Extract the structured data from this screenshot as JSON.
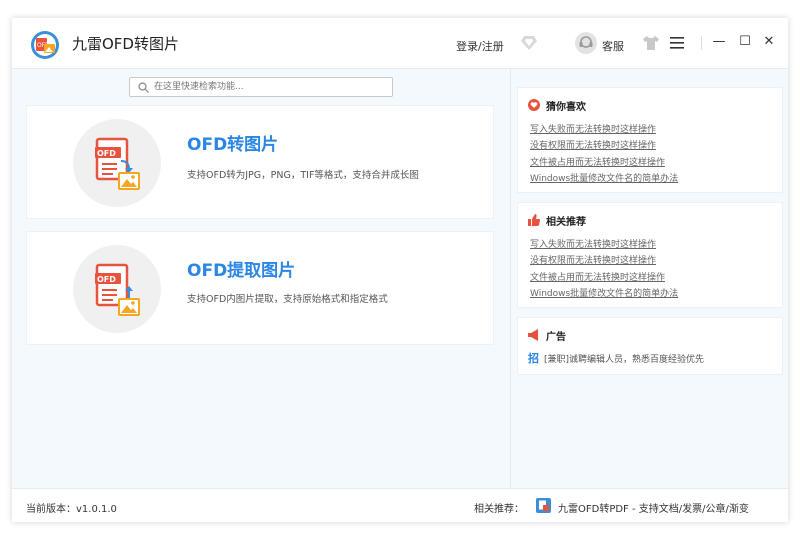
{
  "app": {
    "title": "九雷OFD转图片",
    "login_label": "登录/注册",
    "service_label": "客服"
  },
  "window_controls": {
    "minimize": "—",
    "maximize": "☐",
    "close": "✕"
  },
  "search": {
    "placeholder": "在这里快速检索功能..."
  },
  "features": [
    {
      "title": "OFD转图片",
      "description": "支持OFD转为JPG，PNG，TIF等格式，支持合并成长图"
    },
    {
      "title": "OFD提取图片",
      "description": "支持OFD内图片提取，支持原始格式和指定格式"
    }
  ],
  "sidebar": {
    "guess": {
      "title": "猜你喜欢",
      "links": [
        "写入失败而无法转换时这样操作",
        "没有权限而无法转换时这样操作",
        "文件被占用而无法转换时这样操作",
        "Windows批量修改文件名的简单办法"
      ]
    },
    "related": {
      "title": "相关推荐",
      "links": [
        "写入失败而无法转换时这样操作",
        "没有权限而无法转换时这样操作",
        "文件被占用而无法转换时这样操作",
        "Windows批量修改文件名的简单办法"
      ]
    },
    "ad": {
      "title": "广告",
      "icon_text": "招",
      "text": "[兼职]诚聘编辑人员，熟悉百度经验优先"
    }
  },
  "status": {
    "version": "当前版本：v1.0.1.0",
    "recommend_label": "相关推荐：",
    "recommend_link": "九雷OFD转PDF - 支持文档/发票/公章/渐变"
  },
  "colors": {
    "accent": "#2b86e4",
    "icon_red": "#e8533e",
    "icon_orange": "#f5a623"
  }
}
